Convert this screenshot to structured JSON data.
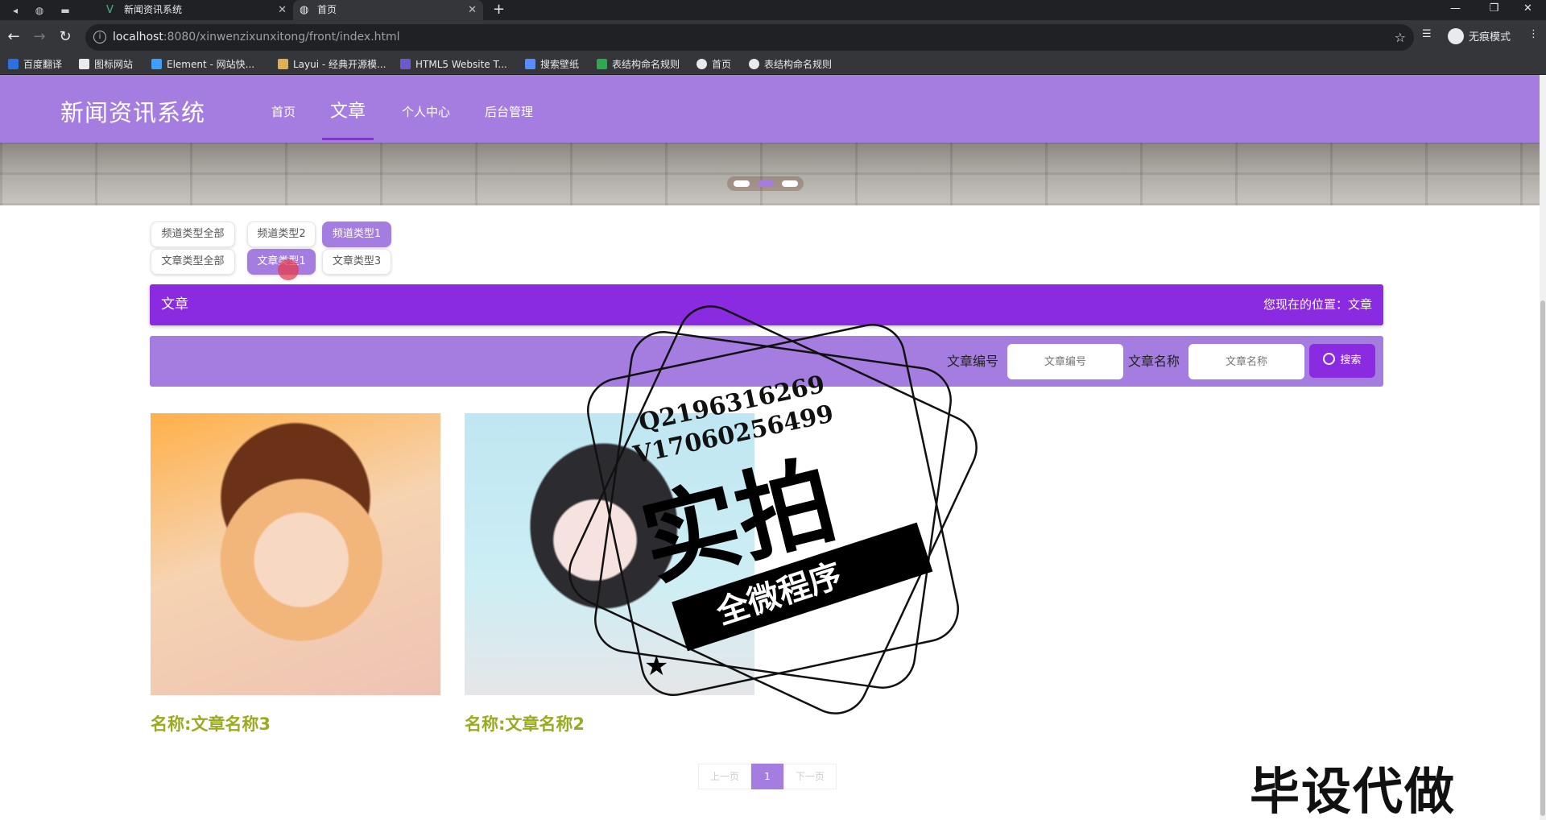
{
  "browser": {
    "tabs": [
      {
        "title": "新闻资讯系统",
        "active": false
      },
      {
        "title": "首页",
        "active": true
      }
    ],
    "url_host": "localhost",
    "url_path": ":8080/xinwenzixunxitong/front/index.html",
    "incognito_label": "无痕模式",
    "bookmarks": [
      "百度翻译",
      "图标网站",
      "Element - 网站快...",
      "Layui - 经典开源模...",
      "HTML5 Website T...",
      "搜索壁纸",
      "表结构命名规则",
      "首页",
      "表结构命名规则"
    ]
  },
  "header": {
    "logo": "新闻资讯系统",
    "nav": [
      "首页",
      "文章",
      "个人中心",
      "后台管理"
    ],
    "active_nav": "文章"
  },
  "filters": {
    "row1": [
      "频道类型全部",
      "频道类型2",
      "频道类型1"
    ],
    "row2": [
      "文章类型全部",
      "文章类型1",
      "文章类型3"
    ],
    "selected_row1": "频道类型1",
    "selected_row2": "文章类型1"
  },
  "titlebar": {
    "title": "文章",
    "location": "您现在的位置：文章"
  },
  "search": {
    "field1_label": "文章编号",
    "field1_placeholder": "文章编号",
    "field2_label": "文章名称",
    "field2_placeholder": "文章名称",
    "button": "搜索"
  },
  "articles": [
    {
      "name": "名称:文章名称3"
    },
    {
      "name": "名称:文章名称2"
    }
  ],
  "pagination": {
    "prev": "上一页",
    "current": "1",
    "next": "下一页"
  },
  "watermarks": {
    "stamp_line1": "Q2196316269",
    "stamp_line2": "V17060256499",
    "stamp_big": "实拍",
    "stamp_ribbon": "全微程序",
    "corner": "毕设代做"
  },
  "colors": {
    "header": "#a57de0",
    "accent": "#8a2be2",
    "article_name": "#9aab1f"
  }
}
